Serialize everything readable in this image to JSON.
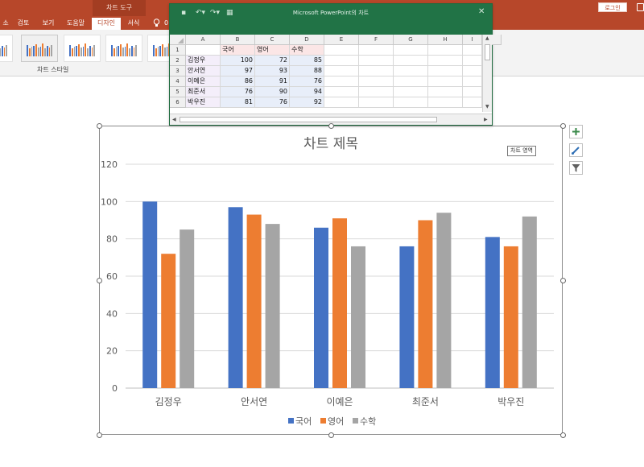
{
  "ribbon": {
    "context_tab_label": "차트 도구",
    "login_label": "로그인",
    "tabs": [
      {
        "label": "소",
        "left": 0,
        "width": 14,
        "active": false
      },
      {
        "label": "검토",
        "left": 17,
        "width": 24,
        "active": false
      },
      {
        "label": "보기",
        "left": 48,
        "width": 24,
        "active": false
      },
      {
        "label": "도움말",
        "left": 78,
        "width": 32,
        "active": false
      },
      {
        "label": "디자인",
        "left": 114,
        "width": 36,
        "active": true
      },
      {
        "label": "서식",
        "left": 154,
        "width": 24,
        "active": false
      }
    ],
    "tell_me": "0",
    "chart_styles_label": "차트 스타일"
  },
  "excel": {
    "title": "Microsoft PowerPoint의 차트",
    "columns": [
      "A",
      "B",
      "C",
      "D",
      "E",
      "F",
      "G",
      "H",
      "I"
    ],
    "rows": [
      "1",
      "2",
      "3",
      "4",
      "5",
      "6"
    ],
    "headers": [
      "국어",
      "영어",
      "수학"
    ],
    "data": [
      {
        "name": "김정우",
        "values": [
          100,
          72,
          85
        ]
      },
      {
        "name": "안서연",
        "values": [
          97,
          93,
          88
        ]
      },
      {
        "name": "이예은",
        "values": [
          86,
          91,
          76
        ]
      },
      {
        "name": "최준서",
        "values": [
          76,
          90,
          94
        ]
      },
      {
        "name": "박우진",
        "values": [
          81,
          76,
          92
        ]
      }
    ]
  },
  "tooltip": "차트 영역",
  "chart_data": {
    "type": "bar",
    "title": "차트 제목",
    "categories": [
      "김정우",
      "안서연",
      "이예은",
      "최준서",
      "박우진"
    ],
    "series": [
      {
        "name": "국어",
        "values": [
          100,
          97,
          86,
          76,
          81
        ],
        "color": "#4472c4"
      },
      {
        "name": "영어",
        "values": [
          72,
          93,
          91,
          90,
          76
        ],
        "color": "#ed7d31"
      },
      {
        "name": "수학",
        "values": [
          85,
          88,
          76,
          94,
          92
        ],
        "color": "#a5a5a5"
      }
    ],
    "ylim": [
      0,
      120
    ],
    "yticks": [
      0,
      20,
      40,
      60,
      80,
      100,
      120
    ],
    "grid": true,
    "legend": "bottom"
  }
}
